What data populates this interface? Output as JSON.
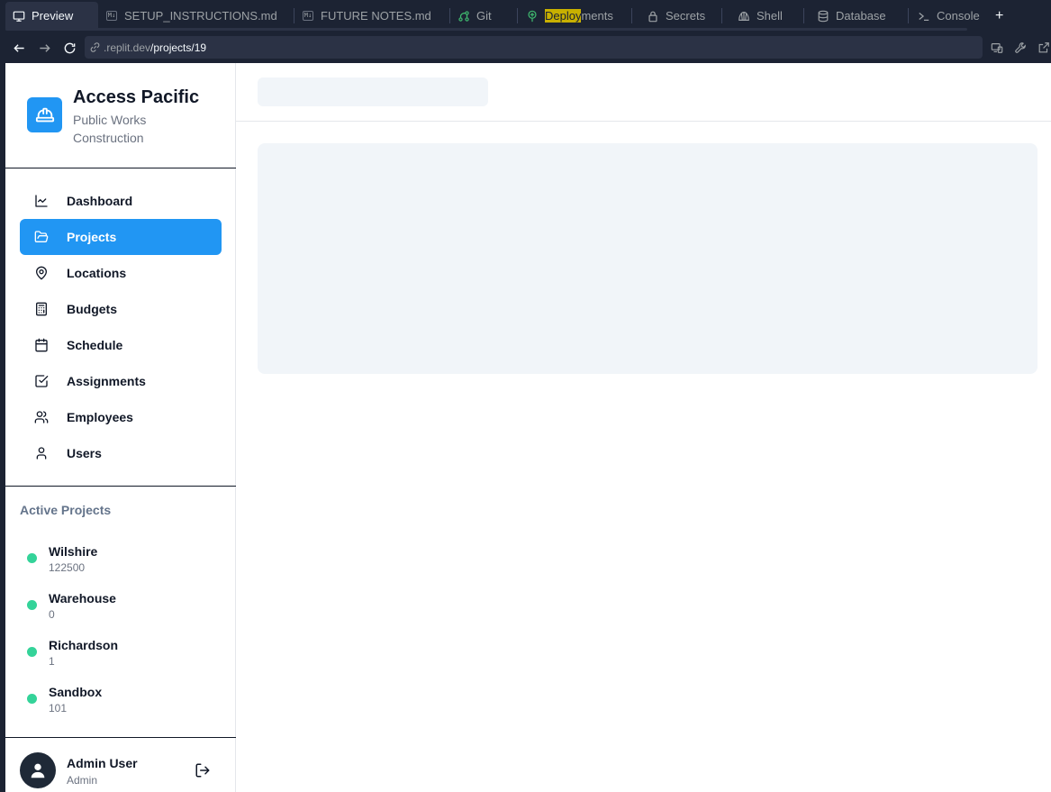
{
  "ide": {
    "tabs": [
      {
        "label": "Preview",
        "icon": "monitor-icon"
      },
      {
        "label": "SETUP_INSTRUCTIONS.md",
        "icon": "markdown-icon"
      },
      {
        "label": "FUTURE NOTES.md",
        "icon": "markdown-icon"
      },
      {
        "label": "Git",
        "icon": "git-icon"
      },
      {
        "label_highlight": "Deploy",
        "label_rest": "ments",
        "icon": "deployments-icon"
      },
      {
        "label": "Secrets",
        "icon": "lock-icon"
      },
      {
        "label": "Shell",
        "icon": "shell-icon"
      },
      {
        "label": "Database",
        "icon": "database-icon"
      },
      {
        "label": "Console",
        "icon": "console-icon"
      }
    ],
    "md_badge": "M↓",
    "add_tab": "+",
    "url": {
      "host": ".replit.dev",
      "path": "/projects/19"
    }
  },
  "sidebar": {
    "brand": {
      "title": "Access Pacific",
      "subtitle": "Public Works Construction"
    },
    "nav": [
      {
        "label": "Dashboard",
        "icon": "chart-line-icon"
      },
      {
        "label": "Projects",
        "icon": "folder-open-icon",
        "active": true
      },
      {
        "label": "Locations",
        "icon": "map-pin-icon"
      },
      {
        "label": "Budgets",
        "icon": "calculator-icon"
      },
      {
        "label": "Schedule",
        "icon": "calendar-icon"
      },
      {
        "label": "Assignments",
        "icon": "check-square-icon"
      },
      {
        "label": "Employees",
        "icon": "users-icon"
      },
      {
        "label": "Users",
        "icon": "user-icon"
      }
    ],
    "active_projects": {
      "title": "Active Projects",
      "items": [
        {
          "name": "Wilshire",
          "value": "122500"
        },
        {
          "name": "Warehouse",
          "value": "0"
        },
        {
          "name": "Richardson",
          "value": "1"
        },
        {
          "name": "Sandbox",
          "value": "101"
        }
      ]
    },
    "user": {
      "name": "Admin User",
      "role": "Admin"
    }
  },
  "colors": {
    "accent": "#2196f3",
    "status_active": "#34d399",
    "skeleton": "#f1f5f9",
    "ide_bg": "#1c2333"
  }
}
